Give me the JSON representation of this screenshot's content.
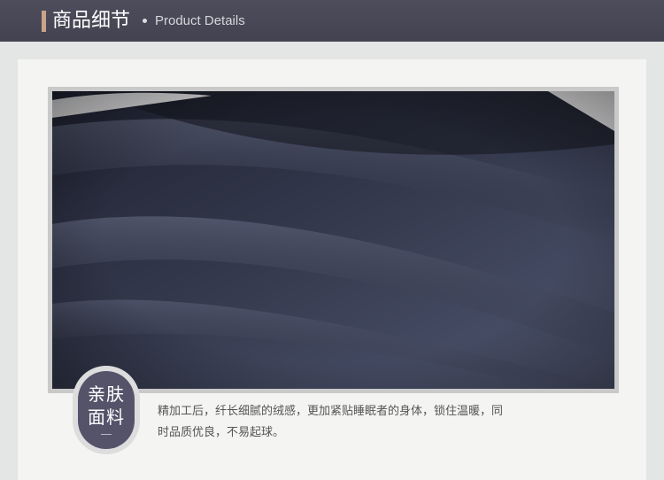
{
  "header": {
    "title_cn": "商品细节",
    "title_en": "Product Details",
    "bg_color": "#48475a",
    "accent_color": "#c9a48a"
  },
  "detail": {
    "badge_line1": "亲肤",
    "badge_line2": "面料",
    "description_line1": "精加工后，纤长细腻的绒感，更加紧贴睡眠者的身体，锁住温暖，同",
    "description_line2": "时品质优良，不易起球。",
    "badge_color": "#54536a"
  },
  "icons": {
    "accent": "accent-bar-icon",
    "separator": "bullet-dot-icon"
  }
}
